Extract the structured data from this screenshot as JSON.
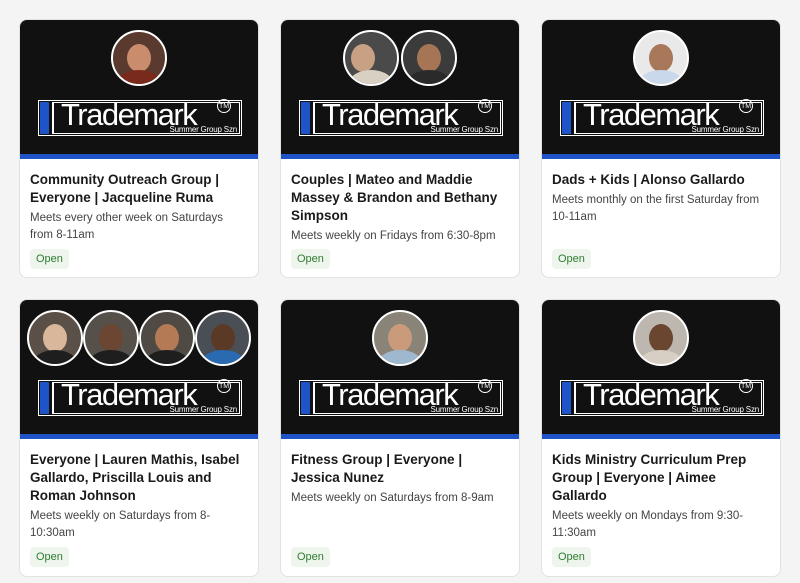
{
  "logo": {
    "wordmark": "Trademark",
    "tm": "TM",
    "subtitle": "Summer Group Szn"
  },
  "accent_color": "#1f54c8",
  "status_color": "#2e7d32",
  "groups": [
    {
      "title": "Community Outreach Group | Everyone | Jacqueline Ruma",
      "schedule": "Meets every other week on Saturdays from 8-11am",
      "status": "Open",
      "leader_photos": [
        "leader-photo"
      ]
    },
    {
      "title": "Couples | Mateo and Maddie Massey & Brandon and Bethany Simpson",
      "schedule": "Meets weekly on Fridays from 6:30-8pm",
      "status": "Open",
      "leader_photos": [
        "leader-photo",
        "leader-photo"
      ]
    },
    {
      "title": "Dads + Kids | Alonso Gallardo",
      "schedule": "Meets monthly on the first Saturday from 10-11am",
      "status": "Open",
      "leader_photos": [
        "leader-photo"
      ]
    },
    {
      "title": "Everyone | Lauren Mathis, Isabel Gallardo, Priscilla Louis and Roman Johnson",
      "schedule": "Meets weekly on Saturdays from 8-10:30am",
      "status": "Open",
      "leader_photos": [
        "leader-photo",
        "leader-photo",
        "leader-photo",
        "leader-photo"
      ]
    },
    {
      "title": "Fitness Group | Everyone | Jessica Nunez",
      "schedule": "Meets weekly on Saturdays from 8-9am",
      "status": "Open",
      "leader_photos": [
        "leader-photo"
      ]
    },
    {
      "title": "Kids Ministry Curriculum Prep Group | Everyone | Aimee Gallardo",
      "schedule": "Meets weekly on Mondays from 9:30-11:30am",
      "status": "Open",
      "leader_photos": [
        "leader-photo"
      ]
    }
  ]
}
